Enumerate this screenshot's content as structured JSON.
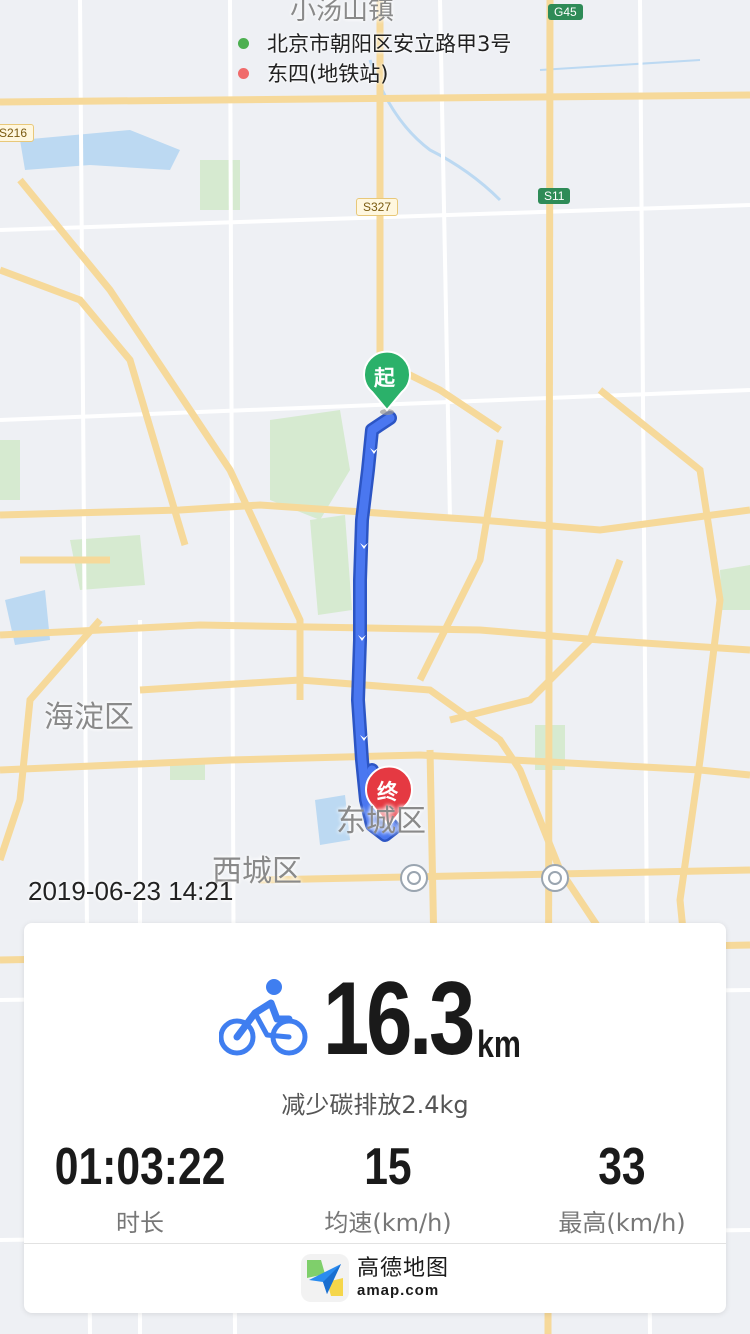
{
  "route": {
    "origin": "北京市朝阳区安立路甲3号",
    "destination": "东四(地铁站)",
    "origin_color": "#4caf50",
    "destination_color": "#f06b6b"
  },
  "map": {
    "labels": {
      "town_north": "小汤山镇",
      "haidian": "海淀区",
      "dongcheng": "东城区",
      "xicheng": "西城区"
    },
    "road_badges": {
      "s327": "S327",
      "s11": "S11",
      "s216": "S216",
      "g45": "G45"
    },
    "markers": {
      "start": "起",
      "end": "终"
    },
    "route_color": "#4a77f0"
  },
  "timestamp": "2019-06-23 14:21",
  "summary": {
    "distance": "16.3",
    "distance_unit": "km",
    "activity_icon": "bicycle-icon",
    "carbon_text": "减少碳排放2.4kg",
    "accent_color": "#3f7ef0"
  },
  "stats": [
    {
      "value": "01:03:22",
      "label": "时长"
    },
    {
      "value": "15",
      "label": "均速(km/h)"
    },
    {
      "value": "33",
      "label": "最高(km/h)"
    }
  ],
  "brand": {
    "name": "高德地图",
    "domain": "amap.com"
  }
}
